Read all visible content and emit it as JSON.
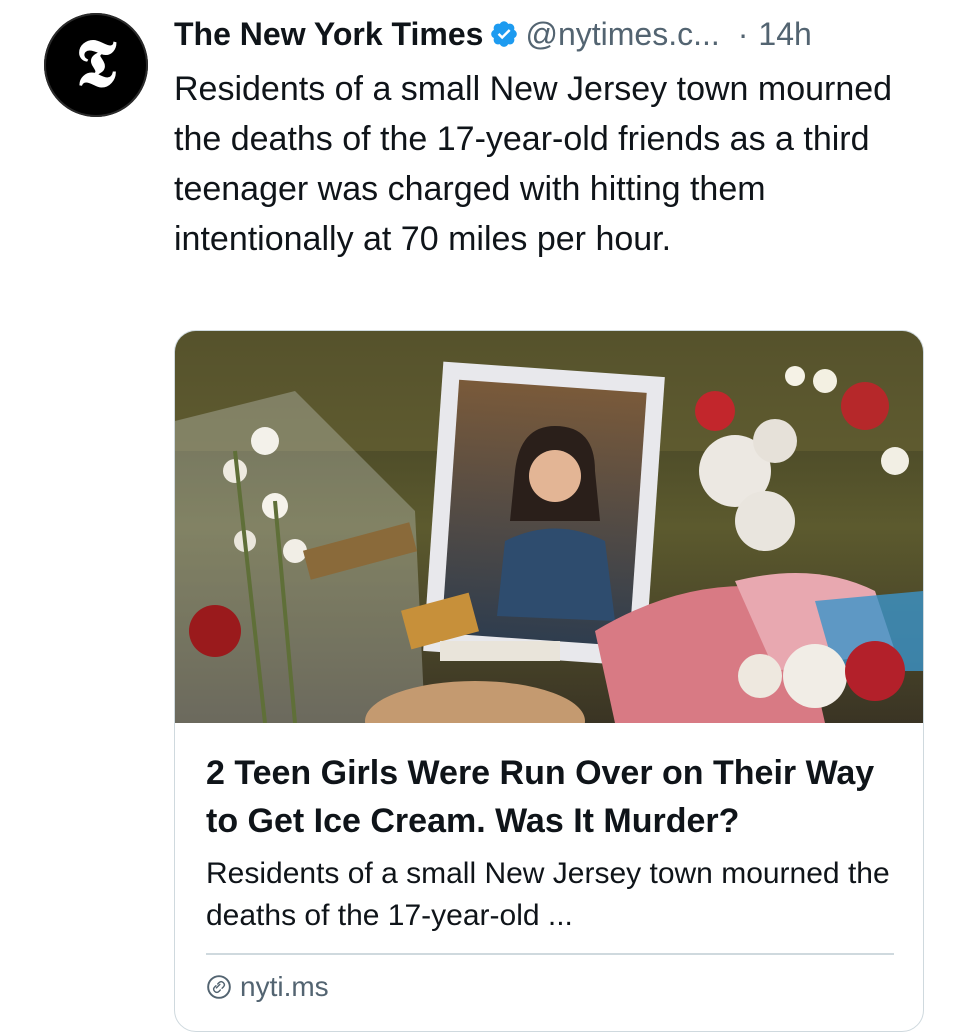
{
  "author": {
    "name": "The New York Times",
    "logo_glyph": "𝕿",
    "handle": "@nytimes.c...",
    "separator": "·",
    "time": "14h",
    "verified_color": "#1d9bf0"
  },
  "tweet": {
    "text": "Residents of a small New Jersey town mourned the deaths of the 17-year-old friends as a third teenager was charged with hitting them intentionally at 70 miles per hour."
  },
  "card": {
    "image_icon": "memorial-photo",
    "title": "2 Teen Girls Were Run Over on Their Way to Get Ice Cream. Was It Murder?",
    "description": "Residents of a small New Jersey town mourned the deaths of the 17-year-old ...",
    "domain": "nyti.ms",
    "domain_icon": "link-icon"
  }
}
